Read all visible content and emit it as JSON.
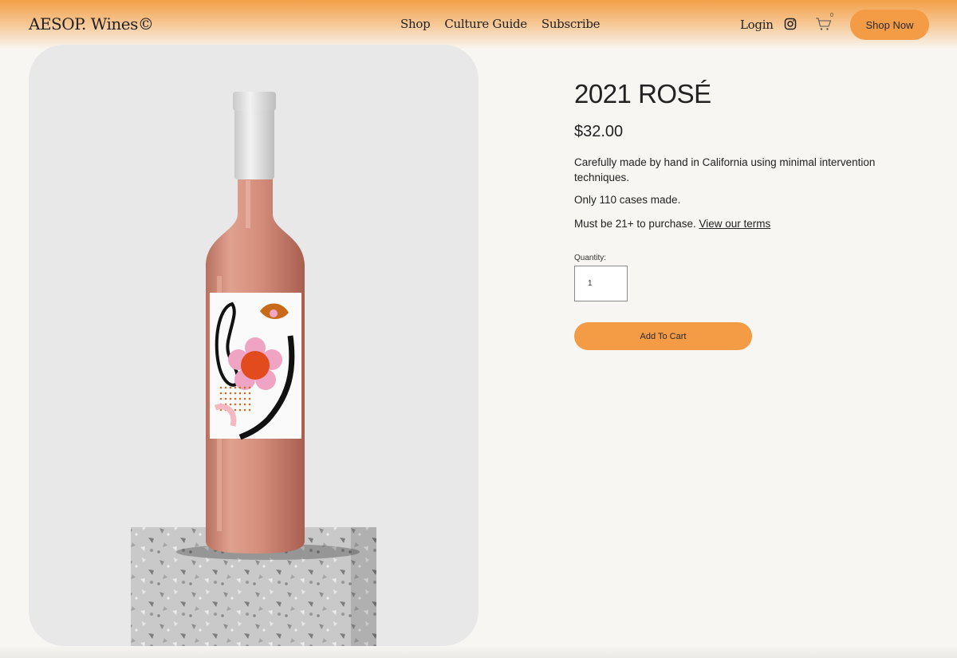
{
  "header": {
    "logo": "AESOP. Wines©",
    "nav": [
      {
        "label": "Shop"
      },
      {
        "label": "Culture Guide"
      },
      {
        "label": "Subscribe"
      }
    ],
    "login_label": "Login",
    "instagram_icon": "instagram-icon",
    "cart_icon": "cart-icon",
    "cart_count": "0",
    "shop_now_label": "Shop Now"
  },
  "product": {
    "title": "2021 ROSÉ",
    "price": "$32.00",
    "description": "Carefully made by hand in California using minimal intervention techniques.",
    "cases": "Only 110 cases made.",
    "age_notice": "Must be 21+ to purchase.",
    "terms_link": "View our terms",
    "quantity_label": "Quantity:",
    "quantity_value": "1",
    "add_to_cart_label": "Add To Cart"
  },
  "colors": {
    "accent": "#f39b45",
    "background": "#f7f6f2",
    "image_card": "#e8e8e8",
    "wine": "#d9907e"
  }
}
